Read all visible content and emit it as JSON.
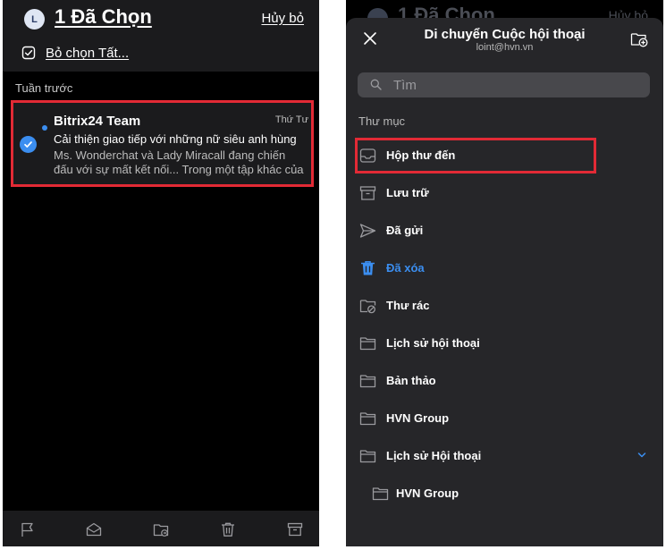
{
  "left_screen": {
    "header": {
      "avatar_initial": "L",
      "title": "1 Đã Chọn",
      "cancel_label": "Hủy bỏ",
      "select_all_label": "Bỏ chọn Tất..."
    },
    "section_label": "Tuần trước",
    "mail": {
      "sender": "Bitrix24 Team",
      "date": "Thứ Tư",
      "subject": "Cải thiện giao tiếp với những nữ siêu anh hùng",
      "preview_line1": "Ms. Wonderchat và Lady Miracall đang chiến",
      "preview_line2": "đấu với sự mất kết nối... Trong một tập khác của",
      "unread": true,
      "selected": true
    },
    "toolbar": {
      "icons": [
        "flag-icon",
        "mark-read-icon",
        "move-folder-icon",
        "trash-icon",
        "archive-icon"
      ]
    }
  },
  "right_screen": {
    "behind": {
      "title": "1 Đã Chọn",
      "cancel_label": "Hủy bỏ"
    },
    "sheet": {
      "title": "Di chuyển Cuộc hội thoại",
      "subtitle": "loint@hvn.vn",
      "search_placeholder": "Tìm",
      "folders_label": "Thư mục",
      "folders": [
        {
          "label": "Hộp thư đến",
          "icon": "inbox-icon"
        },
        {
          "label": "Lưu trữ",
          "icon": "archive-icon"
        },
        {
          "label": "Đã gửi",
          "icon": "sent-icon"
        },
        {
          "label": "Đã xóa",
          "icon": "trash-icon",
          "active": true
        },
        {
          "label": "Thư rác",
          "icon": "junk-folder-icon"
        },
        {
          "label": "Lịch sử hội thoại",
          "icon": "folder-icon"
        },
        {
          "label": "Bản thảo",
          "icon": "folder-icon"
        },
        {
          "label": "HVN Group",
          "icon": "folder-icon"
        },
        {
          "label": "Lịch sử Hội thoại",
          "icon": "folder-icon",
          "expandable": true
        },
        {
          "label": "HVN Group",
          "icon": "folder-icon",
          "sub": true
        }
      ]
    }
  },
  "colors": {
    "accent": "#3b8ef0",
    "highlight_red": "#e22a35",
    "sheet_bg": "#262629",
    "header_bg": "#1b1b1d"
  }
}
